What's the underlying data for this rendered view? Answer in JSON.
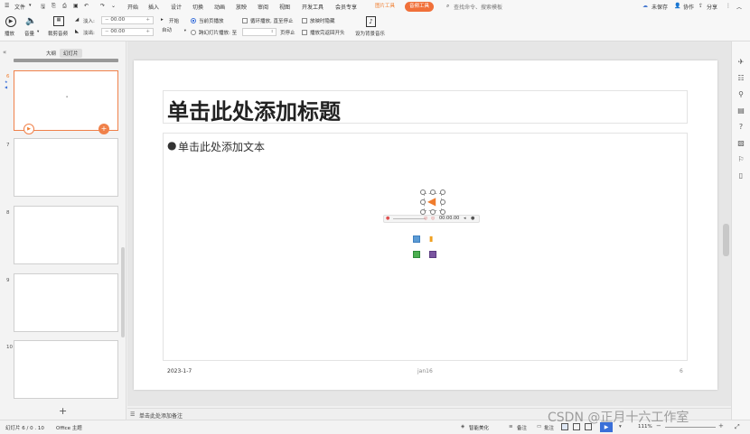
{
  "menubar": {
    "file_menu": "文件",
    "tabs": [
      "开始",
      "插入",
      "设计",
      "切换",
      "动画",
      "放映",
      "审阅",
      "视图",
      "开发工具",
      "会员专享"
    ],
    "picture_tools": "图片工具",
    "audio_tools": "音频工具",
    "search_placeholder": "查找命令、搜索模板",
    "unsaved": "未保存",
    "collab": "协作",
    "share": "分享"
  },
  "ribbon": {
    "play": "播放",
    "volume": "音量",
    "trim_audio": "裁剪音频",
    "fade_in_label": "淡入:",
    "fade_in_value": "00.00",
    "fade_out_label": "淡出:",
    "fade_out_value": "00.00",
    "start_label": "开始",
    "start_value": "自动",
    "current_page_play": "当前页播放",
    "cross_slide_play": "跨幻灯片播放: 至",
    "pages_stop": "页停止",
    "loop_play": "循环播放, 直至停止",
    "hide_on_show": "放映时隐藏",
    "rewind_after_play": "播放完返回开头",
    "set_bg_music": "设为背景音乐"
  },
  "leftpanel": {
    "tab_outline": "大纲",
    "tab_slides": "幻灯片",
    "slide_numbers": [
      "6",
      "7",
      "8",
      "9",
      "10"
    ],
    "add_slide": "+"
  },
  "slide": {
    "title_placeholder": "单击此处添加标题",
    "body_placeholder": "单击此处添加文本",
    "footer_date": "2023-1-7",
    "footer_center": "jan16",
    "footer_page": "6",
    "audio_time": "00:00.00"
  },
  "notes": {
    "placeholder": "单击此处添加备注"
  },
  "statusbar": {
    "slide_info": "幻灯片 6 / 0 . 10",
    "theme": "Office 主题",
    "smart_beautify": "智能美化",
    "notes": "备注",
    "comments": "批注",
    "zoom": "111%"
  },
  "watermark": "CSDN @正月十六工作室",
  "colors": {
    "accent_orange": "#f07c2d",
    "audio_tools_pill": "#f0703a",
    "selected_thumb_border": "#f0814a"
  }
}
